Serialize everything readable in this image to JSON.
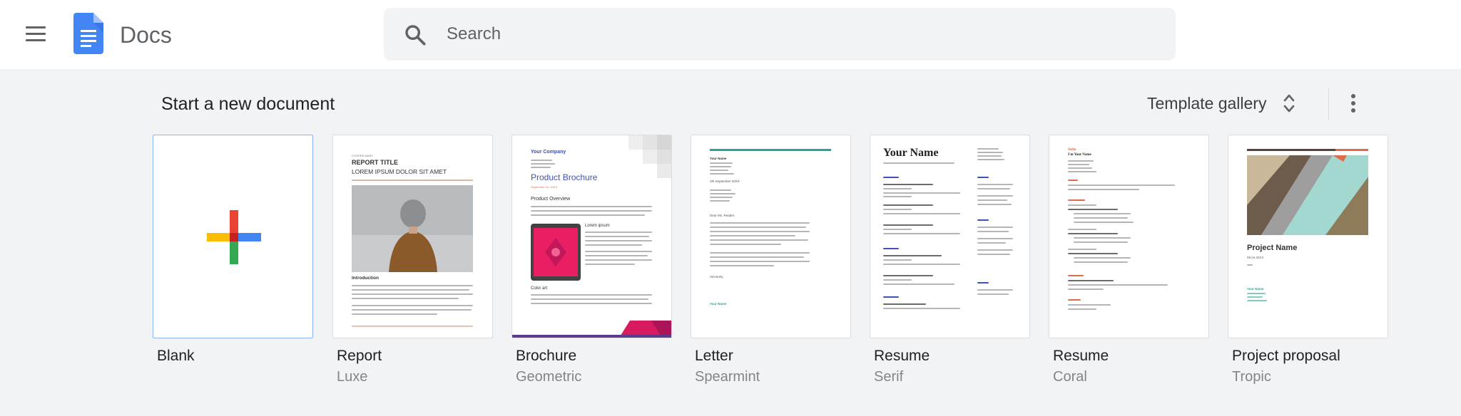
{
  "header": {
    "app_name": "Docs",
    "search_placeholder": "Search"
  },
  "section": {
    "title": "Start a new document",
    "template_gallery_label": "Template gallery"
  },
  "templates": [
    {
      "name": "Blank",
      "subtitle": ""
    },
    {
      "name": "Report",
      "subtitle": "Luxe",
      "preview": {
        "kicker": "COOPER MARY",
        "title": "REPORT TITLE",
        "subtitle": "LOREM IPSUM DOLOR SIT AMET",
        "heading": "Introduction"
      }
    },
    {
      "name": "Brochure",
      "subtitle": "Geometric",
      "preview": {
        "company": "Your Company",
        "title": "Product Brochure",
        "date": "September 04, 20XX",
        "overview": "Product Overview",
        "lorem": "Lorem ipsum",
        "color": "Color art"
      }
    },
    {
      "name": "Letter",
      "subtitle": "Spearmint",
      "preview": {
        "name": "Your Name",
        "date": "4th September 20XX",
        "greeting": "Dear Ms. Reader,",
        "closing": "Sincerely",
        "signature": "Your Name"
      }
    },
    {
      "name": "Resume",
      "subtitle": "Serif",
      "preview": {
        "name": "Your Name"
      }
    },
    {
      "name": "Resume",
      "subtitle": "Coral",
      "preview": {
        "greeting": "Hello",
        "name": "I'm Your Name"
      }
    },
    {
      "name": "Project proposal",
      "subtitle": "Tropic",
      "preview": {
        "title": "Project Name",
        "date": "09.04.20XX",
        "contact": "Your Name"
      }
    }
  ],
  "colors": {
    "brand_blue": "#4285f4",
    "plus_red": "#ea4335",
    "plus_blue": "#4285f4",
    "plus_green": "#34a853",
    "plus_yellow": "#fbbc04",
    "spearmint": "#26a69a",
    "brochure_pink": "#e91e63",
    "coral": "#e06c4a"
  },
  "icons": [
    "menu-icon",
    "docs-logo-icon",
    "search-icon",
    "unfold-more-icon",
    "more-vert-icon",
    "plus-icon"
  ]
}
